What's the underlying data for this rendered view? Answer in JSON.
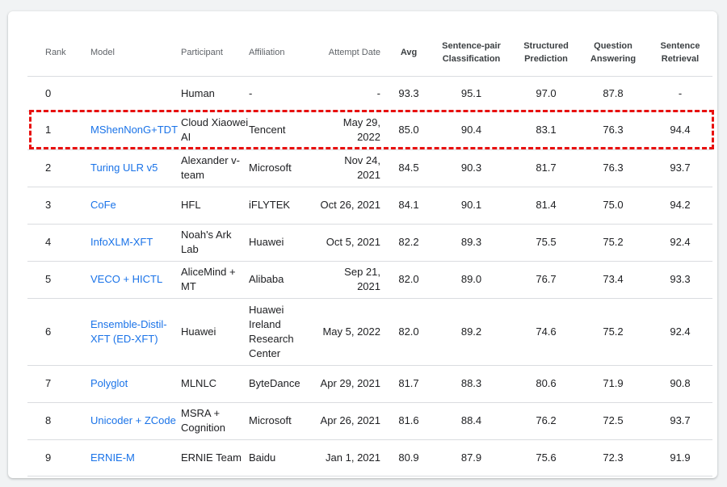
{
  "columns": {
    "rank": "Rank",
    "model": "Model",
    "participant": "Participant",
    "affiliation": "Affiliation",
    "attempt_date": "Attempt Date",
    "avg": "Avg",
    "spc": "Sentence-pair Classification",
    "sp": "Structured Prediction",
    "qa": "Question Answering",
    "sr": "Sentence Retrieval"
  },
  "rows": [
    {
      "rank": "0",
      "model": "",
      "participant": "Human",
      "affiliation": "-",
      "date": "-",
      "avg": "93.3",
      "spc": "95.1",
      "sp": "97.0",
      "qa": "87.8",
      "sr": "-"
    },
    {
      "rank": "1",
      "model": "MShenNonG+TDT",
      "participant": "Cloud Xiaowei AI",
      "affiliation": "Tencent",
      "date": "May 29, 2022",
      "avg": "85.0",
      "spc": "90.4",
      "sp": "83.1",
      "qa": "76.3",
      "sr": "94.4"
    },
    {
      "rank": "2",
      "model": "Turing ULR v5",
      "participant": "Alexander v-team",
      "affiliation": "Microsoft",
      "date": "Nov 24, 2021",
      "avg": "84.5",
      "spc": "90.3",
      "sp": "81.7",
      "qa": "76.3",
      "sr": "93.7"
    },
    {
      "rank": "3",
      "model": "CoFe",
      "participant": "HFL",
      "affiliation": "iFLYTEK",
      "date": "Oct 26, 2021",
      "avg": "84.1",
      "spc": "90.1",
      "sp": "81.4",
      "qa": "75.0",
      "sr": "94.2"
    },
    {
      "rank": "4",
      "model": "InfoXLM-XFT",
      "participant": "Noah's Ark Lab",
      "affiliation": "Huawei",
      "date": "Oct 5, 2021",
      "avg": "82.2",
      "spc": "89.3",
      "sp": "75.5",
      "qa": "75.2",
      "sr": "92.4"
    },
    {
      "rank": "5",
      "model": "VECO + HICTL",
      "participant": "AliceMind + MT",
      "affiliation": "Alibaba",
      "date": "Sep 21, 2021",
      "avg": "82.0",
      "spc": "89.0",
      "sp": "76.7",
      "qa": "73.4",
      "sr": "93.3"
    },
    {
      "rank": "6",
      "model": "Ensemble-Distil-XFT (ED-XFT)",
      "participant": "Huawei",
      "affiliation": "Huawei Ireland Research Center",
      "date": "May 5, 2022",
      "avg": "82.0",
      "spc": "89.2",
      "sp": "74.6",
      "qa": "75.2",
      "sr": "92.4"
    },
    {
      "rank": "7",
      "model": "Polyglot",
      "participant": "MLNLC",
      "affiliation": "ByteDance",
      "date": "Apr 29, 2021",
      "avg": "81.7",
      "spc": "88.3",
      "sp": "80.6",
      "qa": "71.9",
      "sr": "90.8"
    },
    {
      "rank": "8",
      "model": "Unicoder + ZCode",
      "participant": "MSRA + Cognition",
      "affiliation": "Microsoft",
      "date": "Apr 26, 2021",
      "avg": "81.6",
      "spc": "88.4",
      "sp": "76.2",
      "qa": "72.5",
      "sr": "93.7"
    },
    {
      "rank": "9",
      "model": "ERNIE-M",
      "participant": "ERNIE Team",
      "affiliation": "Baidu",
      "date": "Jan 1, 2021",
      "avg": "80.9",
      "spc": "87.9",
      "sp": "75.6",
      "qa": "72.3",
      "sr": "91.9"
    }
  ],
  "colors": {
    "link": "#1a73e8",
    "highlight": "#e8100f"
  }
}
